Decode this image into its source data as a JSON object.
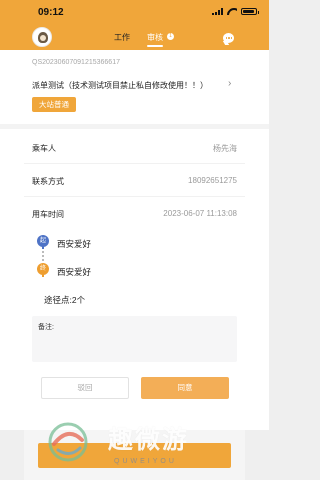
{
  "status_bar": {
    "time": "09:12"
  },
  "header": {
    "tabs": [
      {
        "label": "工作"
      },
      {
        "label": "审核"
      }
    ],
    "review_badge": "1"
  },
  "order": {
    "number": "QS20230607091215366617",
    "title": "派单测试（技术测试项目禁止私自修改使用！！）",
    "station": "大站普通"
  },
  "fields": {
    "passenger_label": "乘车人",
    "passenger_value": "杨先海",
    "contact_label": "联系方式",
    "contact_value": "18092651275",
    "time_label": "用车时间",
    "time_value": "2023-06-07 11:13:08"
  },
  "route": {
    "start_marker": "起",
    "start_place": "西安爱好",
    "end_marker": "终",
    "end_place": "西安爱好",
    "waypoints": "途径点:2个"
  },
  "remark": {
    "label": "备注:"
  },
  "actions": {
    "reject_label": "驳回",
    "approve_label": "同意"
  },
  "watermark": {
    "text": "趣微游",
    "sub": "QUWEIYOU"
  },
  "colors": {
    "accent": "#f0a63a",
    "start_marker": "#4e73c6",
    "end_marker": "#ee9e30"
  }
}
